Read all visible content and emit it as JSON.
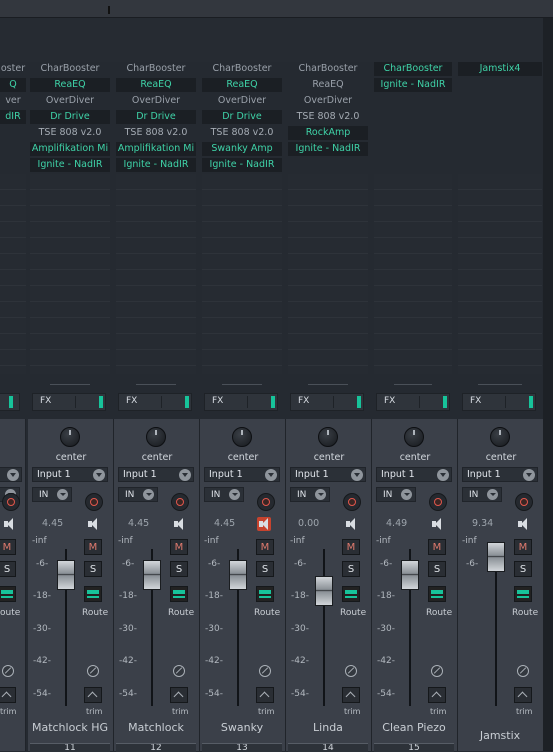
{
  "fx_columns": [
    {
      "name": "col0",
      "items": [
        {
          "label": "oster",
          "active": false
        },
        {
          "label": "Q",
          "active": true
        },
        {
          "label": "ver",
          "active": false
        },
        {
          "label": "dIR",
          "active": true
        }
      ]
    },
    {
      "name": "col1",
      "items": [
        {
          "label": "CharBooster",
          "active": false
        },
        {
          "label": "ReaEQ",
          "active": true
        },
        {
          "label": "OverDiver",
          "active": false
        },
        {
          "label": "Dr Drive",
          "active": true
        },
        {
          "label": "TSE 808 v2.0",
          "active": false
        },
        {
          "label": "Amplifikation Mi",
          "active": true
        },
        {
          "label": "Ignite - NadIR",
          "active": true
        }
      ]
    },
    {
      "name": "col2",
      "items": [
        {
          "label": "CharBooster",
          "active": false
        },
        {
          "label": "ReaEQ",
          "active": true
        },
        {
          "label": "OverDiver",
          "active": false
        },
        {
          "label": "Dr Drive",
          "active": true
        },
        {
          "label": "TSE 808 v2.0",
          "active": false
        },
        {
          "label": "Amplifikation Mi",
          "active": true
        },
        {
          "label": "Ignite - NadIR",
          "active": true
        }
      ]
    },
    {
      "name": "col3",
      "items": [
        {
          "label": "CharBooster",
          "active": false
        },
        {
          "label": "ReaEQ",
          "active": true
        },
        {
          "label": "OverDiver",
          "active": false
        },
        {
          "label": "Dr Drive",
          "active": true
        },
        {
          "label": "TSE 808 v2.0",
          "active": false
        },
        {
          "label": "Swanky Amp",
          "active": true
        },
        {
          "label": "Ignite - NadIR",
          "active": true
        }
      ]
    },
    {
      "name": "col4",
      "items": [
        {
          "label": "CharBooster",
          "active": false
        },
        {
          "label": "ReaEQ",
          "active": false
        },
        {
          "label": "OverDiver",
          "active": false
        },
        {
          "label": "TSE 808 v2.0",
          "active": false
        },
        {
          "label": "RockAmp",
          "active": true
        },
        {
          "label": "Ignite - NadIR",
          "active": true
        }
      ]
    },
    {
      "name": "col5",
      "items": [
        {
          "label": "CharBooster",
          "active": true
        },
        {
          "label": "Ignite - NadIR",
          "active": true
        }
      ]
    },
    {
      "name": "col6",
      "items": [
        {
          "label": "Jamstix4",
          "active": true
        }
      ]
    }
  ],
  "fx_label": "FX",
  "channel_common": {
    "pan": "center",
    "input": "Input 1",
    "in": "IN",
    "mute": "M",
    "solo": "S",
    "route": "Route",
    "trim": "trim",
    "scale": [
      "-inf",
      "-6-",
      "-18-",
      "-30-",
      "-42-",
      "-54-"
    ]
  },
  "strips": [
    {
      "name": "Matchlock HG",
      "level": "4.45",
      "number": "11",
      "speaker_active": false
    },
    {
      "name": "Matchlock",
      "level": "4.45",
      "number": "12",
      "speaker_active": false
    },
    {
      "name": "Swanky",
      "level": "4.45",
      "number": "13",
      "speaker_active": true
    },
    {
      "name": "Linda",
      "level": "0.00",
      "number": "14",
      "speaker_active": false
    },
    {
      "name": "Clean Piezo",
      "level": "4.49",
      "number": "15",
      "speaker_active": false
    },
    {
      "name": "Jamstix",
      "level": "9.34",
      "number": "",
      "speaker_active": false
    }
  ],
  "left_partial": {
    "input_fragment": "",
    "route_fragment": "oute"
  }
}
